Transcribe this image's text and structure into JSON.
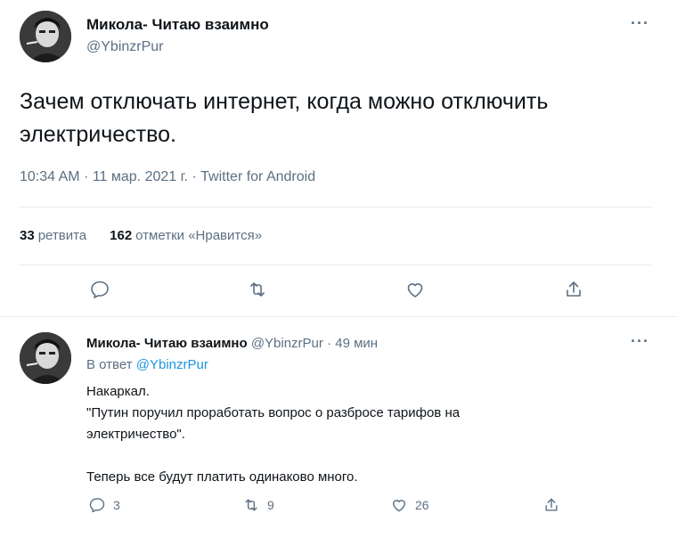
{
  "main_tweet": {
    "author_name": "Микола- Читаю взаимно",
    "author_handle": "@YbinzrPur",
    "more_label": "···",
    "text": "Зачем отключать интернет, когда можно отключить электричество.",
    "meta": "10:34 AM · 11 мар. 2021 г. · Twitter for Android",
    "stats": {
      "retweets_count": "33",
      "retweets_label": "ретвита",
      "likes_count": "162",
      "likes_label": "отметки «Нравится»"
    },
    "actions": {
      "reply_icon": "reply-icon",
      "retweet_icon": "retweet-icon",
      "like_icon": "heart-icon",
      "share_icon": "share-icon"
    }
  },
  "reply_tweet": {
    "author_name": "Микола- Читаю взаимно",
    "author_handle": "@YbinzrPur",
    "separator": "·",
    "time": "49 мин",
    "more_label": "···",
    "reply_prefix": "В ответ",
    "reply_to": "@YbinzrPur",
    "lines": {
      "l1": "Накаркал.",
      "l2": "\"Путин поручил проработать вопрос о разбросе тарифов на",
      "l3": "электричество\".",
      "l4": "Теперь все будут платить одинаково много."
    },
    "counts": {
      "replies": "3",
      "retweets": "9",
      "likes": "26"
    }
  },
  "colors": {
    "text_primary": "#0f1419",
    "text_secondary": "#5b7083",
    "link": "#1b95e0",
    "border": "#e6ecf0"
  }
}
